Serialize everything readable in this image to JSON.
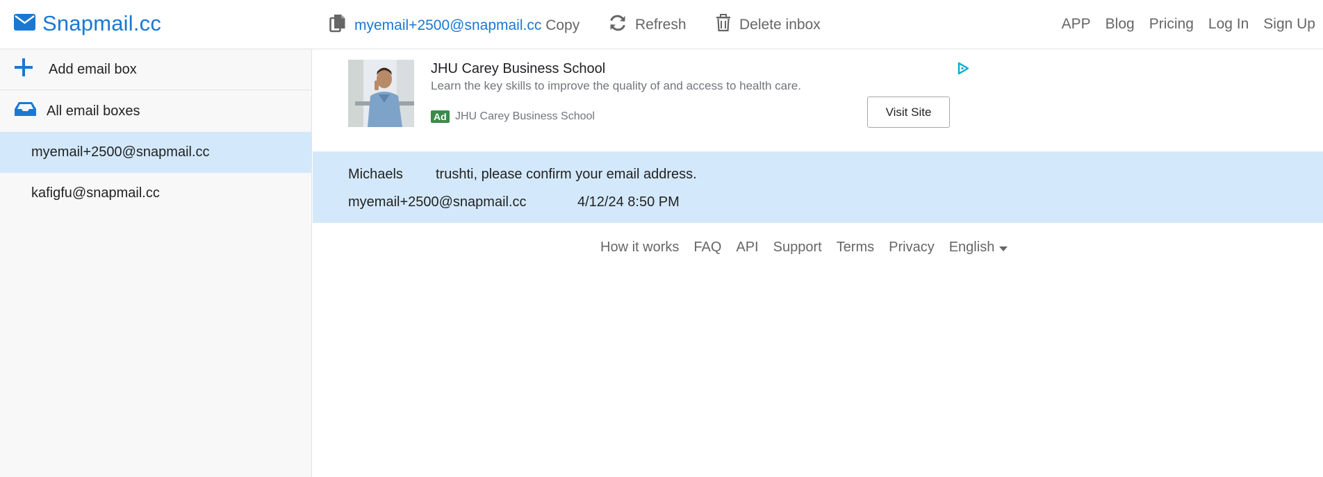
{
  "brand": {
    "name": "Snapmail.cc",
    "color": "#1a78d2"
  },
  "toolbar": {
    "email": "myemail+2500@snapmail.cc",
    "copy_label": "Copy",
    "refresh_label": "Refresh",
    "delete_label": "Delete inbox"
  },
  "nav": [
    "APP",
    "Blog",
    "Pricing",
    "Log In",
    "Sign Up"
  ],
  "sidebar": {
    "add_label": "Add email box",
    "all_label": "All email boxes",
    "boxes": [
      "myemail+2500@snapmail.cc",
      "kafigfu@snapmail.cc"
    ],
    "active_index": 0
  },
  "ad": {
    "title": "JHU Carey Business School",
    "description": "Learn the key skills to improve the quality of and access to health care.",
    "badge": "Ad",
    "advertiser": "JHU Carey Business School",
    "cta": "Visit Site"
  },
  "emails": [
    {
      "from": "Michaels",
      "subject": "trushti, please confirm your email address.",
      "to": "myemail+2500@snapmail.cc",
      "date": "4/12/24 8:50 PM"
    }
  ],
  "footer": {
    "links": [
      "How it works",
      "FAQ",
      "API",
      "Support",
      "Terms",
      "Privacy"
    ],
    "language": "English"
  },
  "colors": {
    "accent": "#1a78d2",
    "selected_bg": "#d3e9fb",
    "muted_text": "#666666"
  }
}
